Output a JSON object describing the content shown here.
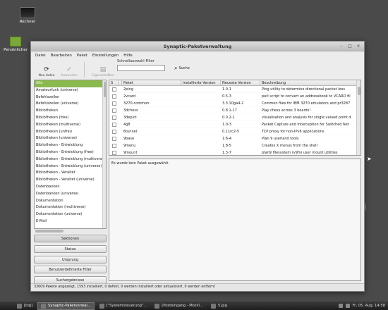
{
  "desktop": {
    "icons": [
      {
        "label": "Rechner",
        "icon": "computer-icon"
      },
      {
        "label": "Persönlicher",
        "icon": "home-folder-icon"
      }
    ]
  },
  "window": {
    "title": "Synaptic-Paketverwaltung",
    "controls": {
      "minimize": "–",
      "maximize": "□",
      "close": "×"
    }
  },
  "menubar": [
    "Datei",
    "Bearbeiten",
    "Paket",
    "Einstellungen",
    "Hilfe"
  ],
  "toolbar": {
    "reload": "Neu laden",
    "mark_all": "Anwenden",
    "apply": "Eigenschaften",
    "quick_filter_label": "Schnellauswahl-Filter",
    "quick_filter_value": "",
    "search": "Suche"
  },
  "categories": {
    "items": [
      "Alle",
      "Amateurfunk (universe)",
      "Befehlszeilen",
      "Befehlszeilen (universe)",
      "Bibliotheken",
      "Bibliotheken (free)",
      "Bibliotheken (multiverse)",
      "Bibliotheken (unfrei)",
      "Bibliotheken (universe)",
      "Bibliotheken - Entwicklung",
      "Bibliotheken - Entwicklung (free)",
      "Bibliotheken - Entwicklung (multiverse)",
      "Bibliotheken - Entwicklung (universe)",
      "Bibliotheken - Veraltet",
      "Bibliotheken - Veraltet (universe)",
      "Datenbanken",
      "Datenbanken (universe)",
      "Dokumentation",
      "Dokumentation (multiverse)",
      "Dokumentation (universe)",
      "E-Mail"
    ],
    "selected_index": 0
  },
  "filter_buttons": [
    "Sektionen",
    "Status",
    "Ursprung",
    "Benutzerdefinierte Filter",
    "Suchergebnisse"
  ],
  "filter_active_index": 0,
  "table": {
    "headers": {
      "s": "S",
      "package": "Paket",
      "installed": "Installierte Version",
      "newest": "Neueste Version",
      "description": "Beschreibung"
    },
    "rows": [
      {
        "package": "2ping",
        "installed": "",
        "newest": "1.0-1",
        "description": "Ping utility to determine directional packet loss"
      },
      {
        "package": "2vcard",
        "installed": "",
        "newest": "0.5-3",
        "description": "perl script to convert an addressbook to VCARD fil"
      },
      {
        "package": "3270-common",
        "installed": "",
        "newest": "3.3.10ga4-2",
        "description": "Common files for IBM 3270 emulators and pr3287"
      },
      {
        "package": "3dchess",
        "installed": "",
        "newest": "0.8.1-17",
        "description": "Play chess across 3 boards!"
      },
      {
        "package": "3depict",
        "installed": "",
        "newest": "0.0.2-1",
        "description": "visualisation and analysis for single valued point d"
      },
      {
        "package": "4g8",
        "installed": "",
        "newest": "1.0-3",
        "description": "Packet Capture and Interception for Switched Net"
      },
      {
        "package": "6tunnel",
        "installed": "",
        "newest": "0.11rc2-5",
        "description": "TCP proxy for non-IPv6 applications"
      },
      {
        "package": "9base",
        "installed": "",
        "newest": "1:6-4",
        "description": "Plan 9 userland tools"
      },
      {
        "package": "9menu",
        "installed": "",
        "newest": "1.8-5",
        "description": "Creates X menus from the shell"
      },
      {
        "package": "9mount",
        "installed": "",
        "newest": "1.3-7",
        "description": "plan9 filesystem (v9fs) user mount utilities"
      }
    ]
  },
  "details_text": "Es wurde kein Paket ausgewählt.",
  "status_text": "33609 Pakete angezeigt, 1593 installiert, 0 defekt, 0 werden installiert oder aktualisiert, 0 werden entfernt",
  "taskbar": {
    "tasks": [
      {
        "label": "[big]",
        "active": false
      },
      {
        "label": "Synaptic-Paketverwal...",
        "active": true
      },
      {
        "label": "[\"Systemsteuerung\"...",
        "active": false
      },
      {
        "label": "[Posteingang - Mozill...",
        "active": false
      },
      {
        "label": "5.jpg",
        "active": false
      }
    ],
    "clock": "Fr, 05. Aug, 14:58"
  },
  "colors": {
    "accent": "#8ab950",
    "taskbar": "#2a2a2a"
  }
}
